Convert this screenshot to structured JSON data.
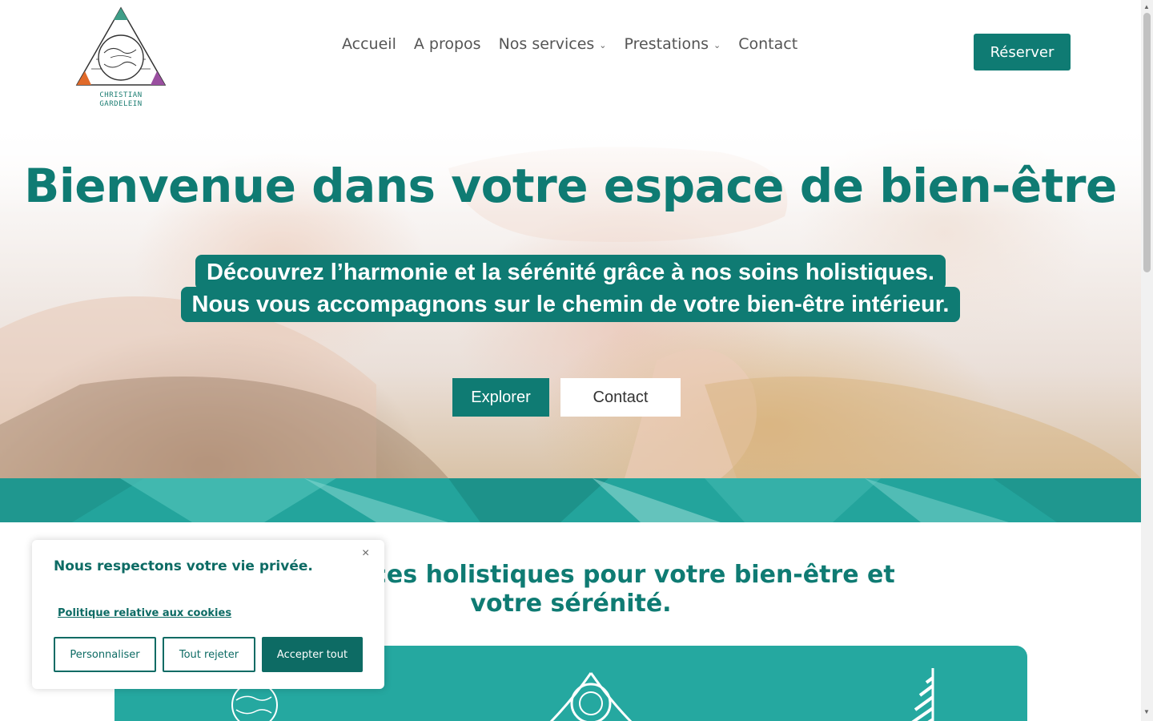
{
  "brand": {
    "name_line1": "CHRISTIAN",
    "name_line2": "GARDELEIN"
  },
  "nav": {
    "items": [
      {
        "label": "Accueil"
      },
      {
        "label": "A propos"
      },
      {
        "label": "Nos services"
      },
      {
        "label": "Prestations"
      },
      {
        "label": "Contact"
      }
    ],
    "cta": "Réserver"
  },
  "hero": {
    "title": "Bienvenue dans votre espace de bien-être",
    "subtitle_line1": "Découvrez l’harmonie et la sérénité grâce à nos soins holistiques.",
    "subtitle_line2": "Nous vous accompagnons sur le chemin de votre bien-être intérieur.",
    "btn_explore": "Explorer",
    "btn_contact": "Contact"
  },
  "services": {
    "title_line1": "Nos services holistiques pour votre bien-être et",
    "title_line2": "votre sérénité."
  },
  "cookie": {
    "title": "Nous respectons votre vie privée.",
    "close": "×",
    "policy_link": "Politique relative aux cookies",
    "btn_customize": "Personnaliser",
    "btn_reject": "Tout rejeter",
    "btn_accept": "Accepter tout"
  },
  "colors": {
    "primary": "#0f7b73",
    "band": "#23a49c",
    "card": "#25a8a0"
  }
}
